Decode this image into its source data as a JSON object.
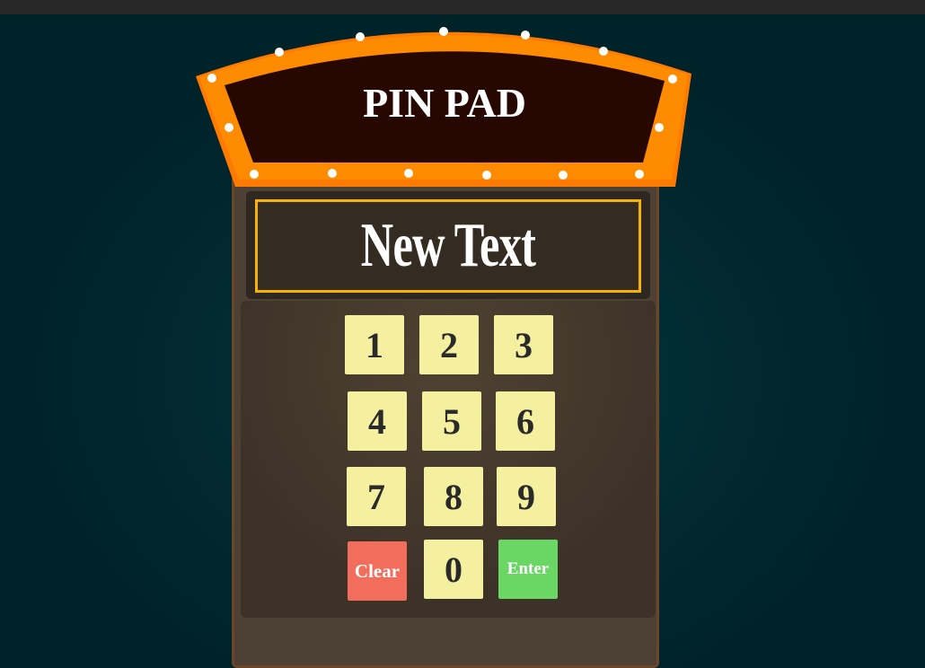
{
  "title": "PIN PAD",
  "display": {
    "text": "New Text"
  },
  "keys": [
    {
      "label": "1",
      "name": "key-1"
    },
    {
      "label": "2",
      "name": "key-2"
    },
    {
      "label": "3",
      "name": "key-3"
    },
    {
      "label": "4",
      "name": "key-4"
    },
    {
      "label": "5",
      "name": "key-5"
    },
    {
      "label": "6",
      "name": "key-6"
    },
    {
      "label": "7",
      "name": "key-7"
    },
    {
      "label": "8",
      "name": "key-8"
    },
    {
      "label": "9",
      "name": "key-9"
    },
    {
      "label": "Clear",
      "name": "clear-button"
    },
    {
      "label": "0",
      "name": "key-0"
    },
    {
      "label": "Enter",
      "name": "enter-button"
    }
  ],
  "colors": {
    "marquee_frame": "#ff8a00",
    "marquee_inner": "#260800",
    "display_border": "#f5b400",
    "key": "#f5f0a0",
    "clear": "#f26d5b",
    "enter": "#6ad663"
  }
}
